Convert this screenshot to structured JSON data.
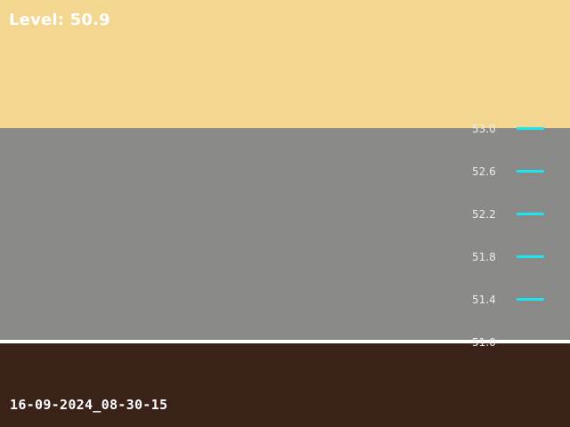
{
  "level": {
    "text": "Level: 50.9",
    "value": 50.9
  },
  "timestamp": "16-09-2024_08-30-15",
  "gauge": {
    "ticks": [
      {
        "label": "53.0",
        "has_mark": true
      },
      {
        "label": "52.6",
        "has_mark": true
      },
      {
        "label": "52.2",
        "has_mark": true
      },
      {
        "label": "51.8",
        "has_mark": true
      },
      {
        "label": "51.4",
        "has_mark": true
      },
      {
        "label": "51.0",
        "has_mark": false
      }
    ],
    "mark_color": "#19e6ee"
  },
  "colors": {
    "sky": "#f3d68f",
    "wall": "#8a8a88",
    "waterline": "#ffffff",
    "water": "#3a2219"
  }
}
